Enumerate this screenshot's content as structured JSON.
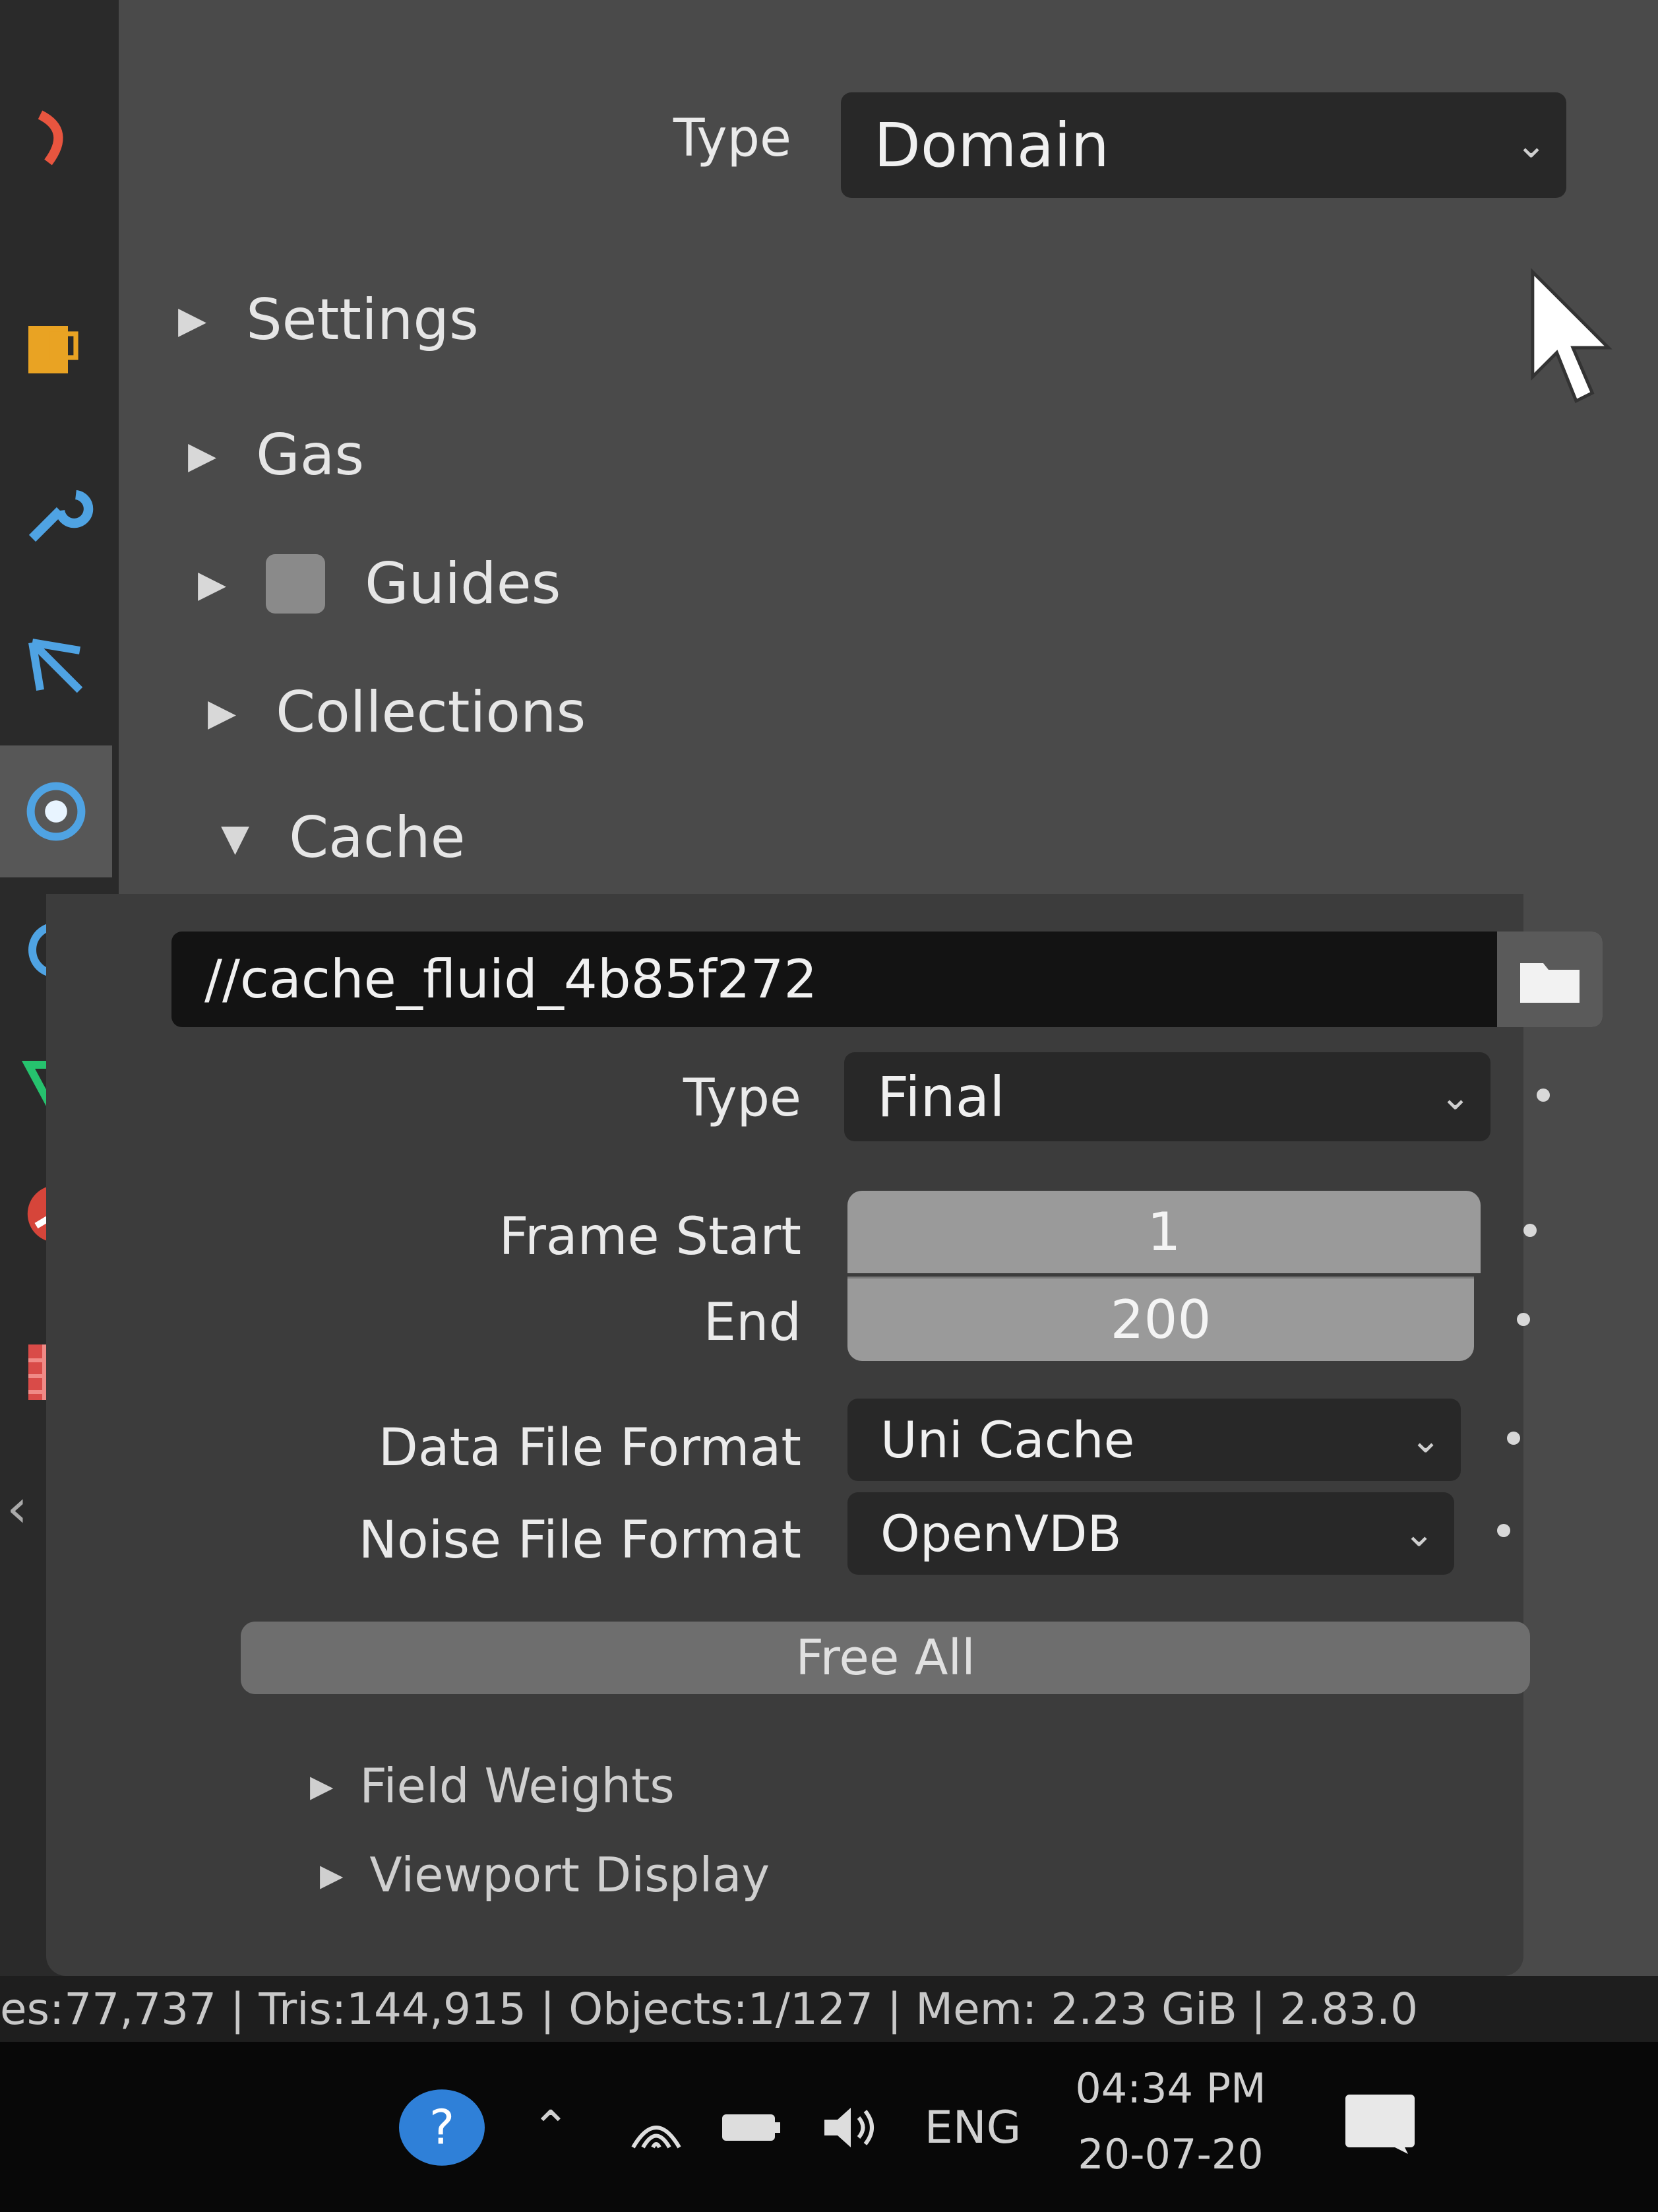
{
  "toolbar": {
    "icons": [
      "particles-icon",
      "physics-icon",
      "modifier-wrench-icon",
      "constraints-icon",
      "fluid-physics-icon",
      "object-data-icon",
      "mesh-data-icon",
      "material-icon",
      "texture-icon"
    ],
    "active_icon": "fluid-physics-icon"
  },
  "fluid": {
    "type_label": "Type",
    "type_value": "Domain"
  },
  "sections": {
    "settings": "Settings",
    "gas": "Gas",
    "guides": "Guides",
    "collections": "Collections",
    "cache": "Cache"
  },
  "cache": {
    "path": "//cache_fluid_4b85f272",
    "type_label": "Type",
    "type_value": "Final",
    "frame_start_label": "Frame Start",
    "frame_start": "1",
    "end_label": "End",
    "end": "200",
    "data_format_label": "Data File Format",
    "data_format_value": "Uni Cache",
    "noise_format_label": "Noise File Format",
    "noise_format_value": "OpenVDB",
    "free_all_label": "Free All"
  },
  "subsections": {
    "field_weights": "Field Weights",
    "viewport_display": "Viewport Display"
  },
  "status_bar": {
    "text": "es:77,737 | Tris:144,915 | Objects:1/127 | Mem: 2.23 GiB | 2.83.0"
  },
  "taskbar": {
    "language": "ENG",
    "time": "04:34 PM",
    "date": "20-07-20"
  },
  "colors": {
    "panel_bg": "#4a4a4a",
    "field_bg": "#282828",
    "number_field_bg": "#9a9a9a",
    "taskbar_bg": "#080808"
  }
}
